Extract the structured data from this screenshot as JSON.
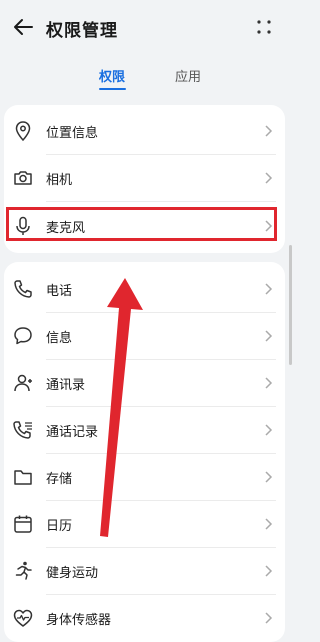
{
  "header": {
    "title": "权限管理"
  },
  "tabs": [
    {
      "label": "权限",
      "active": true
    },
    {
      "label": "应用",
      "active": false
    }
  ],
  "permissions_group1": [
    {
      "label": "位置信息",
      "icon": "location-pin-icon"
    },
    {
      "label": "相机",
      "icon": "camera-icon"
    },
    {
      "label": "麦克风",
      "icon": "microphone-icon"
    }
  ],
  "permissions_group2": [
    {
      "label": "电话",
      "icon": "phone-icon"
    },
    {
      "label": "信息",
      "icon": "message-bubble-icon"
    },
    {
      "label": "通讯录",
      "icon": "contacts-icon"
    },
    {
      "label": "通话记录",
      "icon": "call-log-icon"
    },
    {
      "label": "存储",
      "icon": "folder-icon"
    },
    {
      "label": "日历",
      "icon": "calendar-icon"
    },
    {
      "label": "健身运动",
      "icon": "running-icon"
    },
    {
      "label": "身体传感器",
      "icon": "heart-sensor-icon"
    }
  ],
  "colors": {
    "accent": "#1a6fe0",
    "annotation": "#e0262e"
  }
}
